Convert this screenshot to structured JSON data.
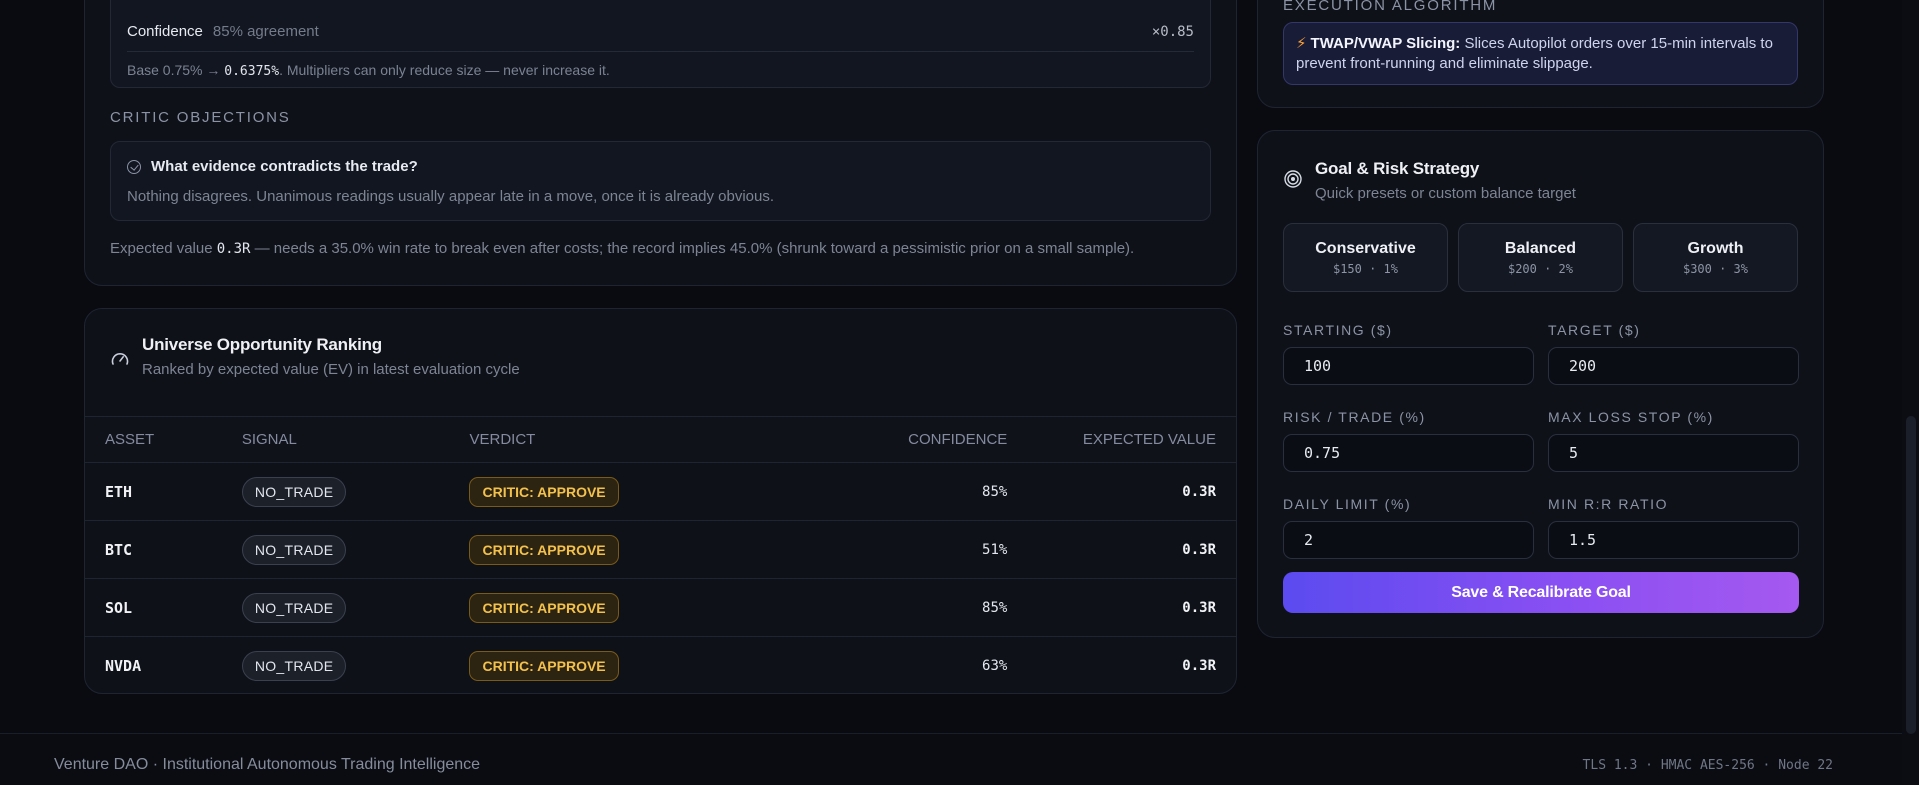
{
  "critic_panel": {
    "confidence_label": "Confidence",
    "confidence_sub": "85% agreement",
    "confidence_multiplier": "×0.85",
    "base_prefix": "Base 0.75% →",
    "base_value": "0.6375%",
    "base_suffix": "Multipliers can only reduce size — never increase it.",
    "objections_heading": "CRITIC OBJECTIONS",
    "objection_question": "What evidence contradicts the trade?",
    "objection_answer": "Nothing disagrees. Unanimous readings usually appear late in a move, once it is already obvious.",
    "ev_prefix": "Expected value",
    "ev_value": "0.3R",
    "ev_suffix": "— needs a 35.0% win rate to break even after costs; the record implies 45.0% (shrunk toward a pessimistic prior on a small sample)."
  },
  "ranking": {
    "title": "Universe Opportunity Ranking",
    "subtitle": "Ranked by expected value (EV) in latest evaluation cycle",
    "columns": {
      "asset": "ASSET",
      "signal": "SIGNAL",
      "verdict": "VERDICT",
      "confidence": "CONFIDENCE",
      "ev": "EXPECTED VALUE"
    },
    "rows": [
      {
        "asset": "ETH",
        "signal": "NO_TRADE",
        "verdict": "CRITIC: APPROVE",
        "confidence": "85%",
        "ev": "0.3R"
      },
      {
        "asset": "BTC",
        "signal": "NO_TRADE",
        "verdict": "CRITIC: APPROVE",
        "confidence": "51%",
        "ev": "0.3R"
      },
      {
        "asset": "SOL",
        "signal": "NO_TRADE",
        "verdict": "CRITIC: APPROVE",
        "confidence": "85%",
        "ev": "0.3R"
      },
      {
        "asset": "NVDA",
        "signal": "NO_TRADE",
        "verdict": "CRITIC: APPROVE",
        "confidence": "63%",
        "ev": "0.3R"
      }
    ]
  },
  "execution": {
    "heading": "EXECUTION ALGORITHM",
    "twap_title": "TWAP/VWAP Slicing:",
    "twap_text": "Slices Autopilot orders over 15-min intervals to prevent front-running and eliminate slippage."
  },
  "goal": {
    "title": "Goal & Risk Strategy",
    "subtitle": "Quick presets or custom balance target",
    "presets": [
      {
        "name": "Conservative",
        "detail": "$150 · 1%"
      },
      {
        "name": "Balanced",
        "detail": "$200 · 2%"
      },
      {
        "name": "Growth",
        "detail": "$300 · 3%"
      }
    ],
    "fields": {
      "starting_label": "STARTING ($)",
      "starting_value": "100",
      "target_label": "TARGET ($)",
      "target_value": "200",
      "risk_label": "RISK / TRADE (%)",
      "risk_value": "0.75",
      "maxloss_label": "MAX LOSS STOP (%)",
      "maxloss_value": "5",
      "daily_label": "DAILY LIMIT (%)",
      "daily_value": "2",
      "rr_label": "MIN R:R RATIO",
      "rr_value": "1.5"
    },
    "save_label": "Save & Recalibrate Goal"
  },
  "footer": {
    "left": "Venture DAO · Institutional Autonomous Trading Intelligence",
    "right": "TLS 1.3 · HMAC AES-256 · Node 22"
  },
  "colors": {
    "accent_gradient_start": "#5b4bf0",
    "accent_gradient_end": "#a559f0",
    "verdict_amber": "#f3c24d",
    "bolt_orange": "#f59e3b"
  },
  "icons": {
    "confidence_check": "check-circle-icon",
    "ranking": "gauge-icon",
    "execution": "bolt-icon",
    "goal": "target-icon"
  }
}
